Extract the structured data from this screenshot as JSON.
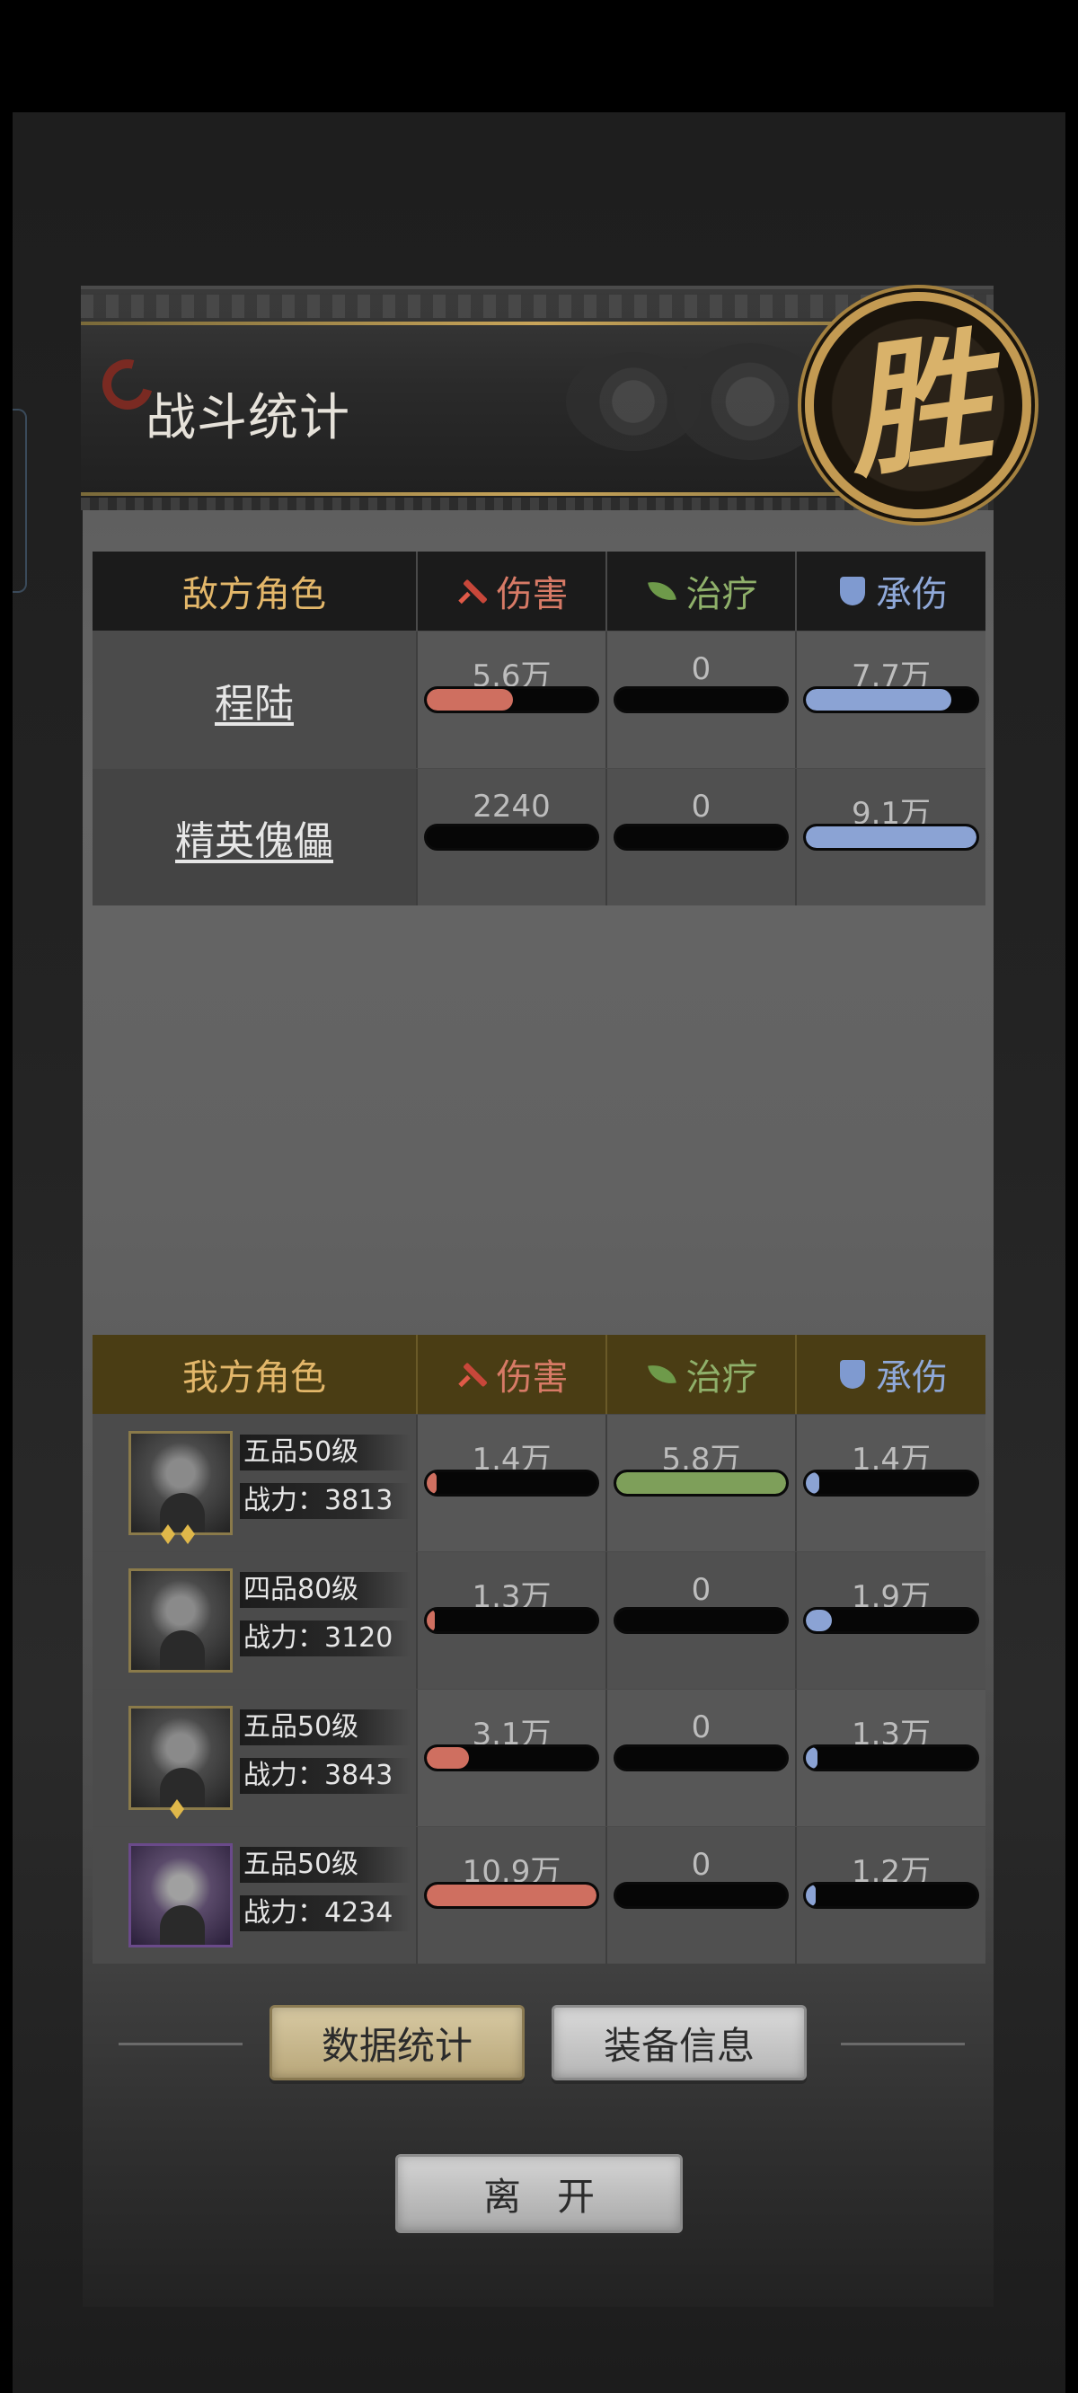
{
  "header": {
    "title": "战斗统计",
    "result_seal": "胜"
  },
  "columns": {
    "damage": "伤害",
    "healing": "治疗",
    "damage_taken": "承伤"
  },
  "enemy": {
    "heading": "敌方角色",
    "rows": [
      {
        "name": "程陆",
        "damage": "5.6万",
        "healing": "0",
        "taken": "7.7万",
        "damage_frac": 0.51,
        "healing_frac": 0,
        "taken_frac": 0.85
      },
      {
        "name": "精英傀儡",
        "damage": "2240",
        "healing": "0",
        "taken": "9.1万",
        "damage_frac": 0,
        "healing_frac": 0,
        "taken_frac": 1.0
      }
    ]
  },
  "ally": {
    "heading": "我方角色",
    "rows": [
      {
        "grade": "五品50级",
        "power": "战力：3813",
        "damage": "1.4万",
        "healing": "5.8万",
        "taken": "1.4万",
        "damage_frac": 0.06,
        "healing_frac": 1.0,
        "taken_frac": 0.08,
        "gems": 2
      },
      {
        "grade": "四品80级",
        "power": "战力：3120",
        "damage": "1.3万",
        "healing": "0",
        "taken": "1.9万",
        "damage_frac": 0.05,
        "healing_frac": 0,
        "taken_frac": 0.15
      },
      {
        "grade": "五品50级",
        "power": "战力：3843",
        "damage": "3.1万",
        "healing": "0",
        "taken": "1.3万",
        "damage_frac": 0.25,
        "healing_frac": 0,
        "taken_frac": 0.07,
        "gems": 1
      },
      {
        "grade": "五品50级",
        "power": "战力：4234",
        "damage": "10.9万",
        "healing": "0",
        "taken": "1.2万",
        "damage_frac": 1.0,
        "healing_frac": 0,
        "taken_frac": 0.06,
        "gems": 0
      }
    ]
  },
  "buttons": {
    "stats": "数据统计",
    "equipment": "装备信息",
    "leave": "离开"
  },
  "colors": {
    "damage": "#cf6f60",
    "healing": "#7e9f5a",
    "taken": "#8ba3d4",
    "gold": "#c39a52"
  }
}
